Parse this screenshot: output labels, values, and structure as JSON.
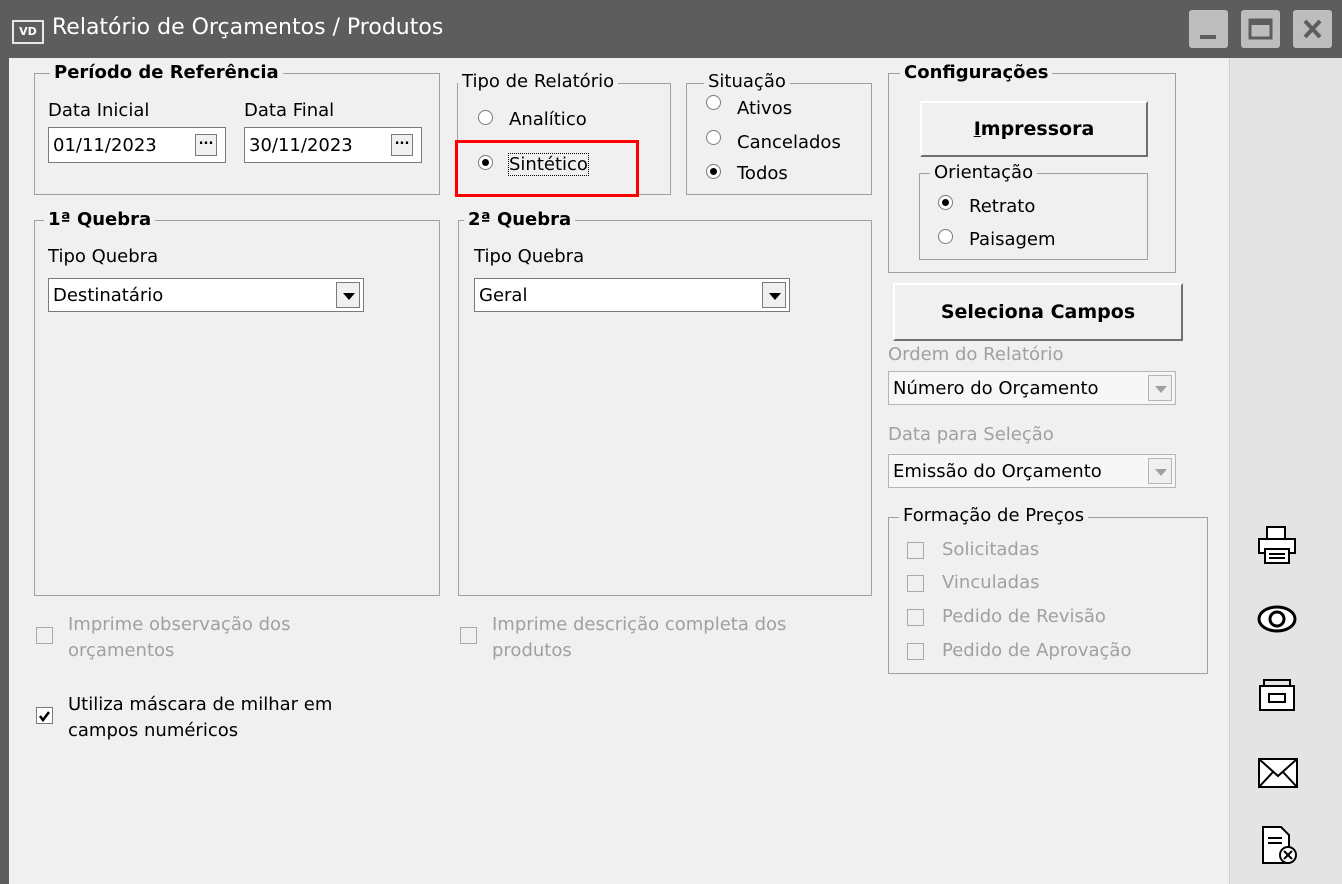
{
  "window": {
    "app_icon": "VD",
    "title": "Relatório de Orçamentos / Produtos",
    "controls": [
      "minimize-icon",
      "maximize-icon",
      "close-icon"
    ]
  },
  "periodo": {
    "legend": "Período de Referência",
    "data_inicial_label": "Data Inicial",
    "data_inicial": "01/11/2023",
    "data_final_label": "Data Final",
    "data_final": "30/11/2023",
    "picker_label": "..."
  },
  "tipo_relatorio": {
    "legend": "Tipo de Relatório",
    "options": [
      "Analítico",
      "Sintético"
    ],
    "selected": "Sintético"
  },
  "situacao": {
    "legend": "Situação",
    "options": [
      "Ativos",
      "Cancelados",
      "Todos"
    ],
    "selected": "Todos"
  },
  "config": {
    "legend": "Configurações",
    "impressora_label": "Impressora",
    "orientacao_legend": "Orientação",
    "orientacao_options": [
      "Retrato",
      "Paisagem"
    ],
    "orientacao_selected": "Retrato",
    "seleciona_campos_label": "Seleciona Campos"
  },
  "quebra1": {
    "legend": "1ª Quebra",
    "tipo_label": "Tipo Quebra",
    "value": "Destinatário"
  },
  "quebra2": {
    "legend": "2ª Quebra",
    "tipo_label": "Tipo Quebra",
    "value": "Geral"
  },
  "ordem": {
    "label": "Ordem do Relatório",
    "value": "Número do Orçamento"
  },
  "data_selecao": {
    "label": "Data para Seleção",
    "value": "Emissão do Orçamento"
  },
  "formacao": {
    "legend": "Formação de Preços",
    "items": [
      "Solicitadas",
      "Vinculadas",
      "Pedido de Revisão",
      "Pedido de Aprovação"
    ]
  },
  "options": {
    "obs_line1": "Imprime observação dos",
    "obs_line2": "orçamentos",
    "desc_line1": "Imprime descrição completa dos",
    "desc_line2": "produtos",
    "mascara_line1": "Utiliza máscara de milhar em",
    "mascara_line2": "campos numéricos",
    "mascara_checked": true
  },
  "side_icons": [
    "printer-icon",
    "eye-preview-icon",
    "folder-export-icon",
    "envelope-icon",
    "document-close-icon"
  ],
  "colors": {
    "titlebar": "#5d5d5d",
    "highlight": "#ff0000",
    "client": "#f0f0f0"
  }
}
